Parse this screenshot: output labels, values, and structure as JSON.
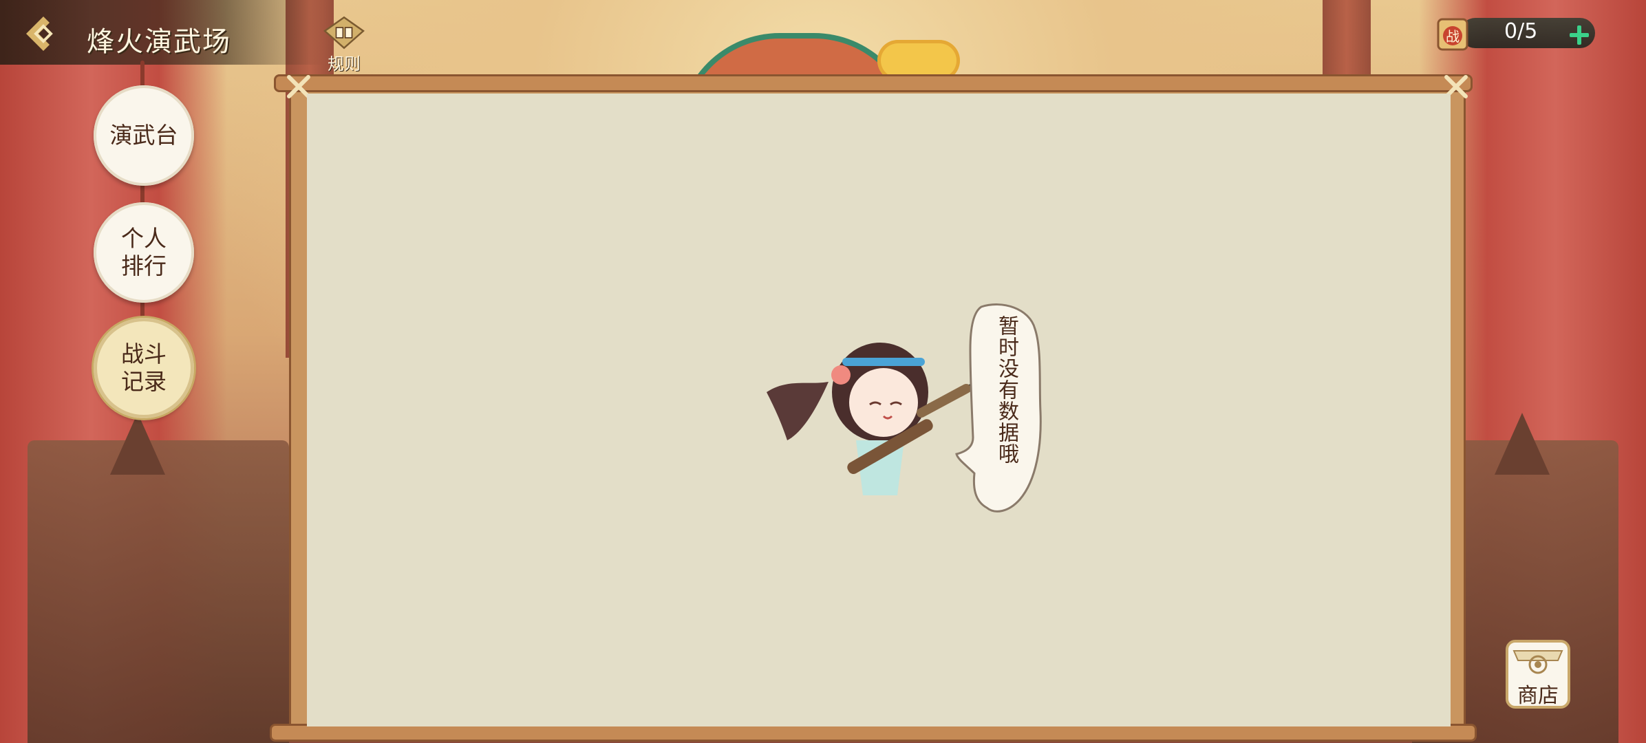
{
  "header": {
    "title": "烽火演武场",
    "rules_label": "规则"
  },
  "resource": {
    "icon_char": "战",
    "count": "0/5"
  },
  "nav": {
    "items": [
      {
        "label_line1": "演武台",
        "label_line2": ""
      },
      {
        "label_line1": "个人",
        "label_line2": "排行"
      },
      {
        "label_line1": "战斗",
        "label_line2": "记录"
      }
    ],
    "active_index": 2
  },
  "empty_state": {
    "message": "暂时没有数据哦"
  },
  "shop": {
    "label": "商店"
  },
  "colors": {
    "accent_green": "#3bd18a",
    "panel_paper": "#e3dec8",
    "text_brown": "#4a2a1a"
  }
}
